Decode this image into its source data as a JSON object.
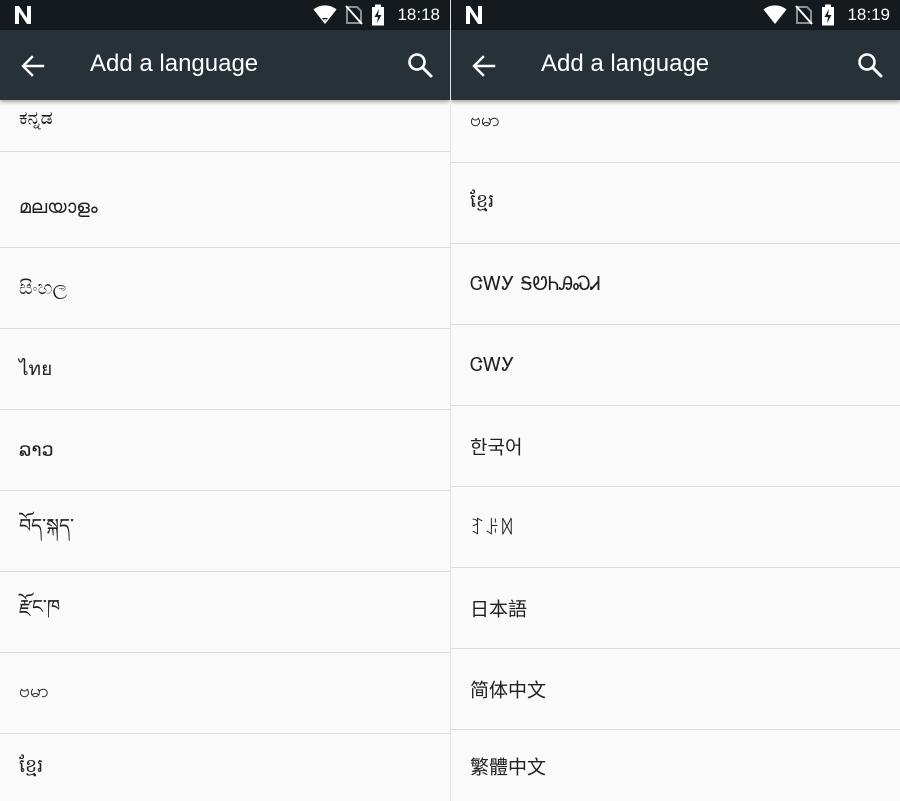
{
  "colors": {
    "status_bar": "#141a1d",
    "app_bar": "#263238",
    "list_background": "#fafafa",
    "divider": "#dcdcdc",
    "text": "#212121"
  },
  "screens": [
    {
      "status_bar": {
        "time": "18:18",
        "icons": [
          "n-logo-icon",
          "wifi-icon",
          "no-sim-icon",
          "battery-charging-icon"
        ]
      },
      "app_bar": {
        "back_icon": "arrow-back-icon",
        "title": "Add a language",
        "search_icon": "search-icon"
      },
      "languages": [
        {
          "label": "ಕನ್ನಡ"
        },
        {
          "label": "മലയാളം"
        },
        {
          "label": "සිංහල"
        },
        {
          "label": "ไทย"
        },
        {
          "label": "ລາວ"
        },
        {
          "label": "བོད་སྐད་"
        },
        {
          "label": "རྫོང་ཁ"
        },
        {
          "label": "ဗမာ"
        },
        {
          "label": "ខ្មែរ"
        }
      ]
    },
    {
      "status_bar": {
        "time": "18:19",
        "icons": [
          "n-logo-icon",
          "wifi-icon",
          "no-sim-icon",
          "battery-charging-icon"
        ]
      },
      "app_bar": {
        "back_icon": "arrow-back-icon",
        "title": "Add a language",
        "search_icon": "search-icon"
      },
      "languages": [
        {
          "label": "ဗမာ"
        },
        {
          "label": "ខ្មែរ"
        },
        {
          "label": "ᏣᎳᎩ ᎦᏬᏂᎯᏍᏗ"
        },
        {
          "label": "ᏣᎳᎩ"
        },
        {
          "label": "한국어"
        },
        {
          "label": "ꆈꌠꉙ"
        },
        {
          "label": "日本語"
        },
        {
          "label": "简体中文"
        },
        {
          "label": "繁體中文"
        }
      ]
    }
  ]
}
